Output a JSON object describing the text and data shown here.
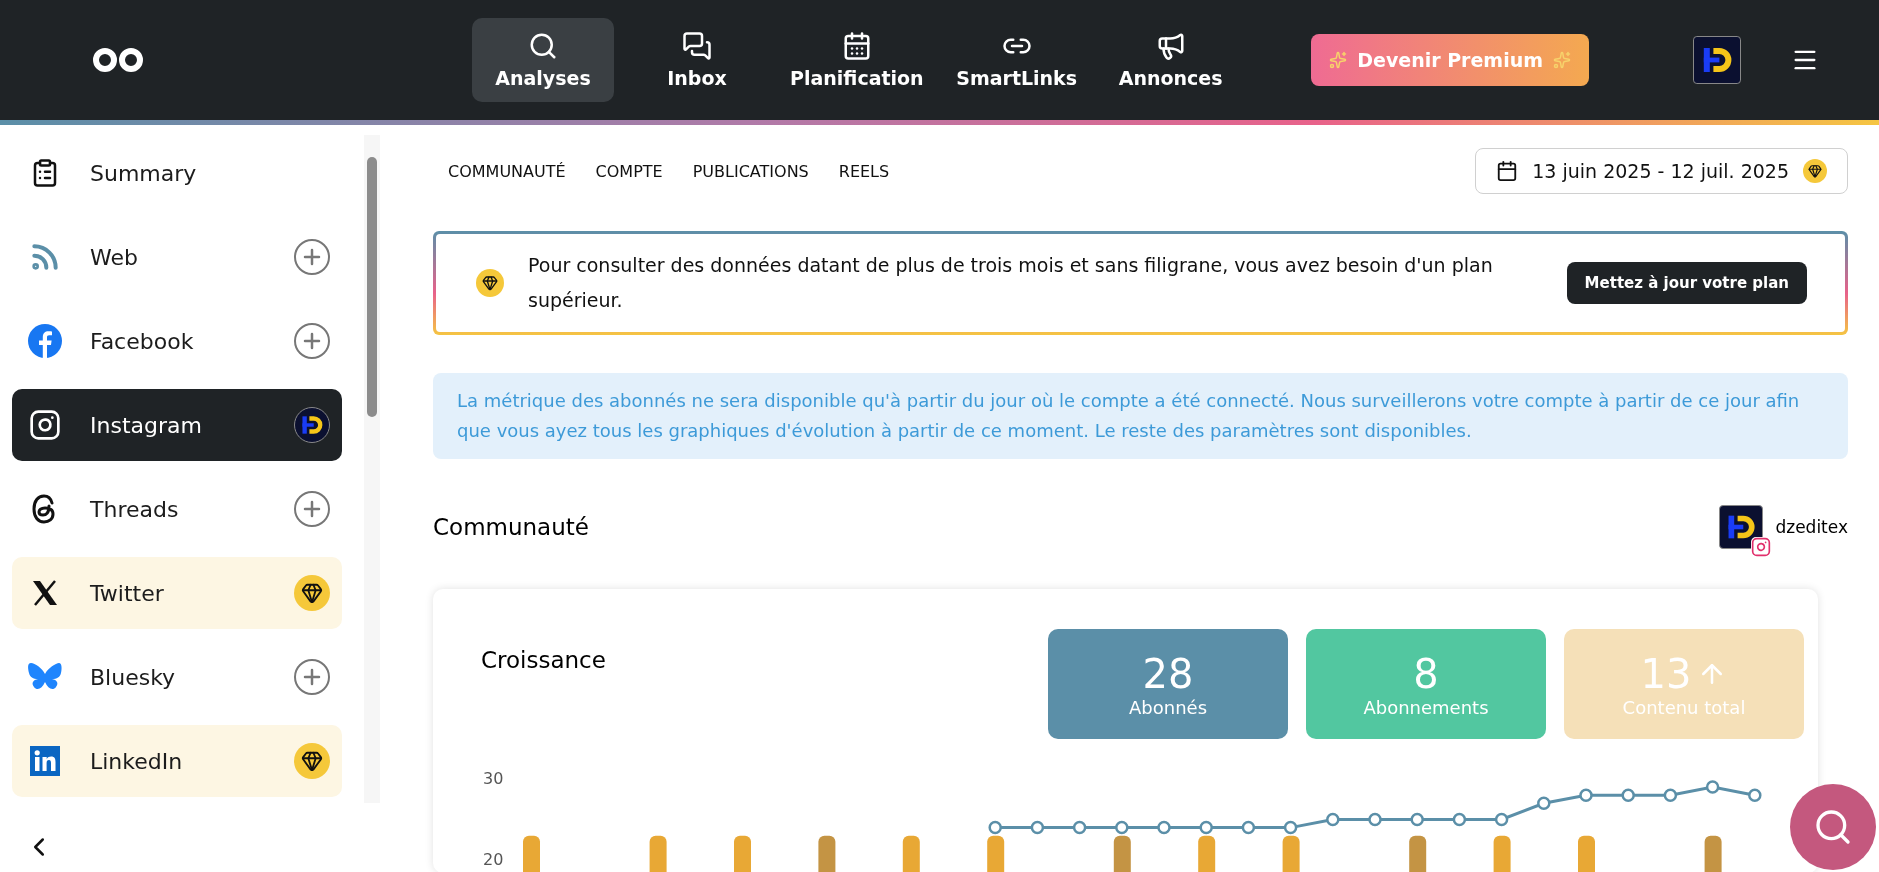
{
  "topbar": {
    "nav": [
      {
        "label": "Analyses",
        "selected": true
      },
      {
        "label": "Inbox",
        "selected": false
      },
      {
        "label": "Planification",
        "selected": false
      },
      {
        "label": "SmartLinks",
        "selected": false
      },
      {
        "label": "Annonces",
        "selected": false
      }
    ],
    "premium_button": "Devenir Premium"
  },
  "sidebar": {
    "items": [
      {
        "label": "Summary",
        "selected": false,
        "kind": "plain"
      },
      {
        "label": "Web",
        "selected": false,
        "kind": "add"
      },
      {
        "label": "Facebook",
        "selected": false,
        "kind": "add"
      },
      {
        "label": "Instagram",
        "selected": true,
        "kind": "account"
      },
      {
        "label": "Threads",
        "selected": false,
        "kind": "add"
      },
      {
        "label": "Twitter",
        "selected": false,
        "kind": "premium"
      },
      {
        "label": "Bluesky",
        "selected": false,
        "kind": "add"
      },
      {
        "label": "LinkedIn",
        "selected": false,
        "kind": "premium"
      }
    ]
  },
  "tabs": [
    "COMMUNAUTÉ",
    "COMPTE",
    "PUBLICATIONS",
    "REELS"
  ],
  "date_range": "13 juin 2025 - 12 juil. 2025",
  "upgrade_banner": {
    "text": "Pour consulter des données datant de plus de trois mois et sans filigrane, vous avez besoin d'un plan supérieur.",
    "button": "Mettez à jour votre plan"
  },
  "info_notice": "La métrique des abonnés ne sera disponible qu'à partir du jour où le compte a été connecté. Nous surveillerons votre compte à partir de ce jour afin que vous ayez tous les graphiques d'évolution à partir de ce moment. Le reste des paramètres sont disponibles.",
  "section": {
    "title": "Communauté",
    "account": "dzeditex"
  },
  "growth_card": {
    "title": "Croissance",
    "stats": [
      {
        "value": "28",
        "label": "Abonnés",
        "color": "#5b8fa8",
        "kind": "plain"
      },
      {
        "value": "8",
        "label": "Abonnements",
        "color": "#52c7a0",
        "kind": "plain"
      },
      {
        "value": "13",
        "label": "Contenu total",
        "color": "#f5e0b8",
        "kind": "trend"
      }
    ],
    "chart_axis_labels": [
      "30",
      "20"
    ]
  }
}
